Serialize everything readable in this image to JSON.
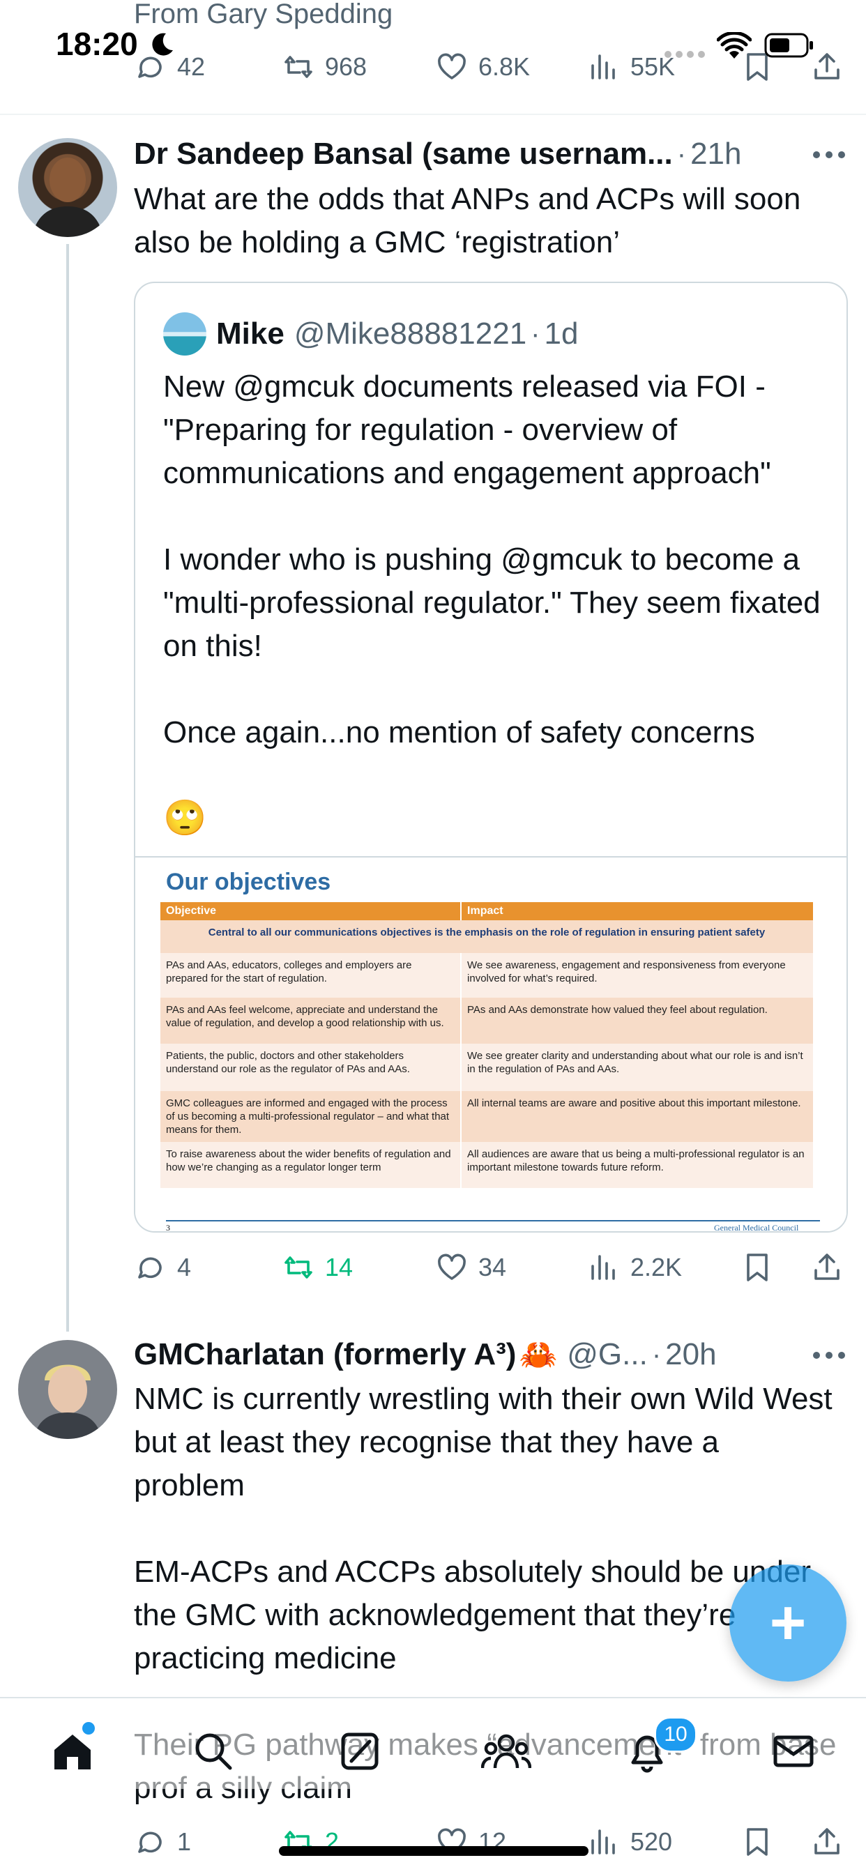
{
  "status_bar": {
    "time": "18:20"
  },
  "prev_tweet": {
    "from_line": "From Gary Spedding",
    "replies": "42",
    "reposts": "968",
    "likes": "6.8K",
    "views": "55K"
  },
  "tweet1": {
    "author": "Dr Sandeep Bansal (same usernam...",
    "sep": "·",
    "time": "21h",
    "text": "What are the odds that ANPs and ACPs will soon also be holding a GMC ‘registration’",
    "quote": {
      "author": "Mike",
      "handle": "@Mike88881221",
      "sep": "·",
      "time": "1d",
      "text": "New @gmcuk documents released via FOI - \"Preparing for regulation - overview of communications and engagement approach\"\n\nI wonder who is pushing @gmcuk to become a \"multi-professional regulator.\" They seem fixated on this!\n\nOnce again...no mention of safety concerns",
      "emoji": "🙄",
      "image": {
        "title": "Our objectives",
        "col_objective": "Objective",
        "col_impact": "Impact",
        "banner": "Central to all our communications objectives is the emphasis on the role of regulation in ensuring patient safety",
        "rows": [
          {
            "objective": "PAs and AAs, educators, colleges and employers are prepared for the start of regulation.",
            "impact": "We see awareness, engagement and responsiveness from everyone involved for what’s required."
          },
          {
            "objective": "PAs and AAs feel welcome, appreciate and understand the value of regulation, and develop a good relationship with us.",
            "impact": "PAs and AAs demonstrate how valued they feel about regulation."
          },
          {
            "objective": "Patients, the public, doctors and other stakeholders understand our role as the regulator of PAs and AAs.",
            "impact": "We see greater clarity and understanding about what our role is and isn’t in the regulation of PAs and AAs."
          },
          {
            "objective": "GMC colleagues are informed and engaged with the process of us becoming a multi-professional regulator – and what that means for them.",
            "impact": "All internal teams are aware and positive about this important milestone."
          },
          {
            "objective": "To raise awareness about the wider benefits of regulation and how we’re changing as a regulator longer term",
            "impact": "All audiences are aware that us being a multi-professional regulator is an important milestone towards future reform."
          }
        ],
        "footer_left": "3",
        "footer_right": "General Medical Council"
      }
    },
    "replies": "4",
    "reposts": "14",
    "likes": "34",
    "views": "2.2K"
  },
  "tweet2": {
    "author": "GMCharlatan (formerly A³)",
    "author_emoji": "🦀",
    "handle": "@G...",
    "sep": "·",
    "time": "20h",
    "text": "NMC is currently wrestling with their own Wild West but at least they recognise that they have a problem\n\nEM-ACPs and ACCPs absolutely should be under the GMC with acknowledgement that they’re practicing medicine\n\nTheir PG pathway makes “advancement” from base prof a silly claim",
    "replies": "1",
    "reposts": "2",
    "likes": "12",
    "views": "520"
  },
  "fab": {
    "label": "+"
  },
  "tab_bar": {
    "notifications_badge": "10"
  },
  "colors": {
    "accent": "#1d9bf0",
    "repost_green": "#00ba7c",
    "table_header": "#e8922e",
    "title_blue": "#2e6ca4"
  }
}
